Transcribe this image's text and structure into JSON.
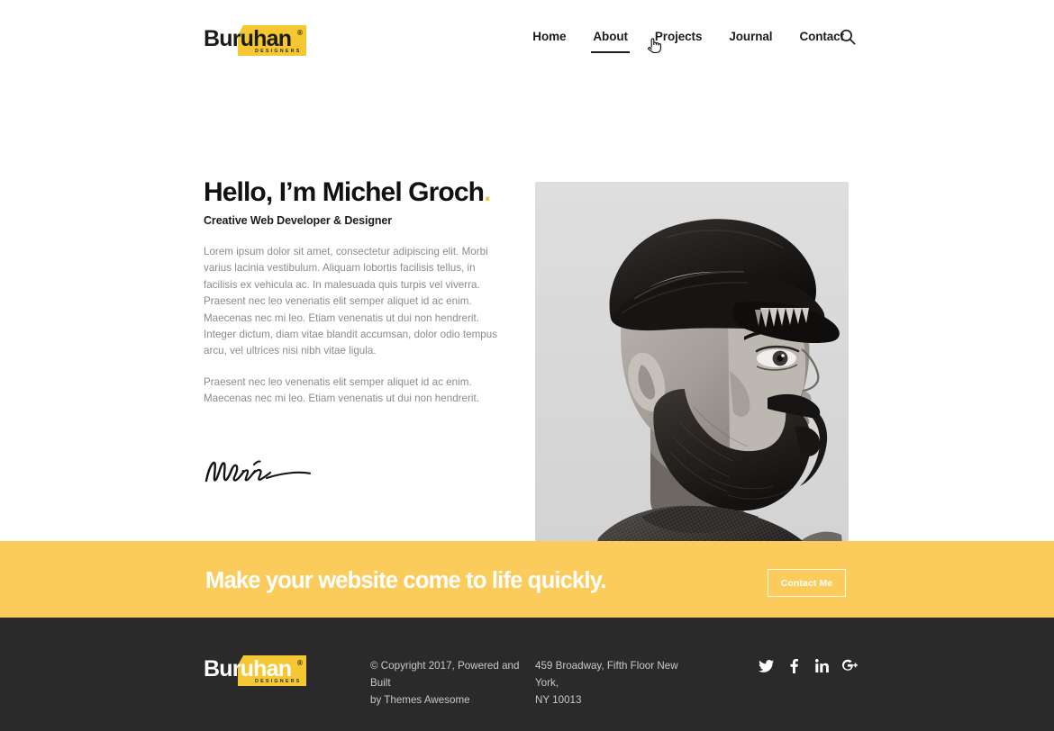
{
  "brand": {
    "name": "Buruhan",
    "registered": "®",
    "tagline": "DESIGNERS",
    "accent_color": "#F5C833"
  },
  "nav": {
    "items": [
      {
        "label": "Home",
        "active": false
      },
      {
        "label": "About",
        "active": true
      },
      {
        "label": "Projects",
        "active": false
      },
      {
        "label": "Journal",
        "active": false
      },
      {
        "label": "Contact",
        "active": false
      }
    ],
    "search_icon": "search-icon"
  },
  "hero": {
    "title": "Hello, I’m Michel Groch",
    "title_dot": ".",
    "subtitle": "Creative Web Developer & Designer",
    "paragraphs": [
      "Lorem ipsum dolor sit amet, consectetur adipiscing elit. Morbi varius lacinia vestibulum. Aliquam lobortis facilisis tellus, in facilisis ex vehicula ac. In malesuada quis turpis vel viverra. Praesent nec leo venenatis elit semper aliquet id ac enim. Maecenas nec mi leo. Etiam venenatis ut dui non hendrerit. Integer dictum, diam vitae blandit accumsan, dolor odio tempus arcu, vel ultrices nisi nibh vitae ligula.",
      "Praesent nec leo venenatis elit semper aliquet id ac enim. Maecenas nec mi leo. Etiam venenatis ut dui non hendrerit."
    ],
    "signature_name": "Michel",
    "portrait_alt": "black and white profile photo of bearded man wearing a flat cap"
  },
  "cta": {
    "title": "Make your website come to life quickly.",
    "button_label": "Contact Me",
    "background_color": "#FBCB5C"
  },
  "footer": {
    "copyright_line1": "© Copyright 2017, Powered and Built",
    "copyright_line2": "by Themes Awesome",
    "address_line1": "459 Broadway, Fifth Floor New York,",
    "address_line2": "NY 10013",
    "background_color": "#2A2A2A",
    "social": [
      {
        "name": "twitter",
        "label": "Twitter"
      },
      {
        "name": "facebook",
        "label": "Facebook"
      },
      {
        "name": "linkedin",
        "label": "LinkedIn"
      },
      {
        "name": "googleplus",
        "label": "Google Plus"
      }
    ]
  }
}
